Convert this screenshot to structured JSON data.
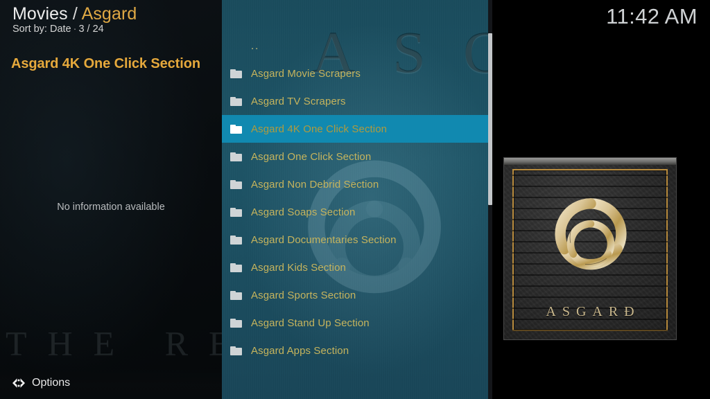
{
  "header": {
    "breadcrumb_root": "Movies",
    "breadcrumb_separator": " / ",
    "breadcrumb_current": "Asgard",
    "sort_label": "Sort by: Date",
    "sort_separator": "·",
    "position": "3 / 24"
  },
  "clock": {
    "time": "11:42 AM"
  },
  "info_panel": {
    "selected_title": "Asgard 4K One Click Section",
    "plot": "No information available"
  },
  "background_watermark": {
    "top_text": "ASGARD",
    "bottom_text": "THE REALM OF STREAMING"
  },
  "list": {
    "items": [
      {
        "label": "..",
        "icon": "parent-folder-icon",
        "selected": false,
        "is_parent": true
      },
      {
        "label": "Asgard Movie Scrapers",
        "icon": "folder-icon",
        "selected": false,
        "is_parent": false
      },
      {
        "label": "Asgard TV Scrapers",
        "icon": "folder-icon",
        "selected": false,
        "is_parent": false
      },
      {
        "label": "Asgard 4K One Click Section",
        "icon": "folder-icon",
        "selected": true,
        "is_parent": false
      },
      {
        "label": "Asgard One Click Section",
        "icon": "folder-icon",
        "selected": false,
        "is_parent": false
      },
      {
        "label": "Asgard Non Debrid Section",
        "icon": "folder-icon",
        "selected": false,
        "is_parent": false
      },
      {
        "label": "Asgard Soaps Section",
        "icon": "folder-icon",
        "selected": false,
        "is_parent": false
      },
      {
        "label": "Asgard Documentaries Section",
        "icon": "folder-icon",
        "selected": false,
        "is_parent": false
      },
      {
        "label": "Asgard Kids Section",
        "icon": "folder-icon",
        "selected": false,
        "is_parent": false
      },
      {
        "label": "Asgard Sports Section",
        "icon": "folder-icon",
        "selected": false,
        "is_parent": false
      },
      {
        "label": "Asgard Stand Up Section",
        "icon": "folder-icon",
        "selected": false,
        "is_parent": false
      },
      {
        "label": "Asgard Apps Section",
        "icon": "folder-icon",
        "selected": false,
        "is_parent": false
      }
    ]
  },
  "artwork": {
    "title_text": "ASGARÐ",
    "emblem": "triple-horn-of-odin-icon"
  },
  "bottom_bar": {
    "options_label": "Options",
    "options_icon": "left-right-chevron-icon"
  },
  "colors": {
    "accent_gold": "#e6a93c",
    "list_text_gold": "#c6b45d",
    "selection_teal": "#1189b0",
    "list_background_teal": "#1c5062",
    "panel_black": "#0a0e11",
    "frame_gold": "#b98c3e"
  }
}
